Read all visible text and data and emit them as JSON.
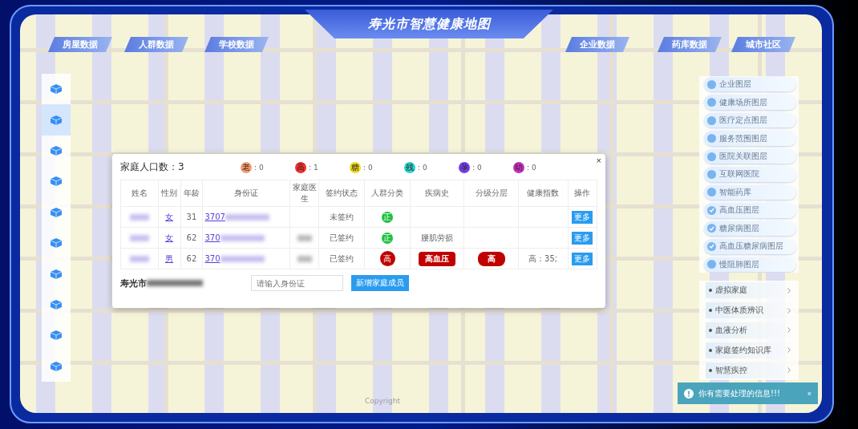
{
  "title": "寿光市智慧健康地图",
  "top_tabs": [
    {
      "label": "房屋数据"
    },
    {
      "label": "人群数据"
    },
    {
      "label": "学校数据"
    },
    {
      "label": "企业数据"
    },
    {
      "label": "药库数据"
    },
    {
      "label": "城市社区"
    }
  ],
  "sidebar": {
    "items": [
      {
        "selected": false
      },
      {
        "selected": true
      },
      {
        "selected": false
      },
      {
        "selected": false
      },
      {
        "selected": false
      },
      {
        "selected": false
      },
      {
        "selected": false
      },
      {
        "selected": false
      },
      {
        "selected": false
      },
      {
        "selected": false
      }
    ]
  },
  "layers": [
    {
      "label": "企业图层",
      "checked": false
    },
    {
      "label": "健康场所图层",
      "checked": false
    },
    {
      "label": "医疗定点图层",
      "checked": false
    },
    {
      "label": "服务范围图层",
      "checked": false
    },
    {
      "label": "医院关联图层",
      "checked": false
    },
    {
      "label": "互联网医院",
      "checked": false
    },
    {
      "label": "智能药库",
      "checked": false
    },
    {
      "label": "高血压图层",
      "checked": true
    },
    {
      "label": "糖尿病图层",
      "checked": true
    },
    {
      "label": "高血压糖尿病图层",
      "checked": true
    },
    {
      "label": "慢阻肺图层",
      "checked": false
    }
  ],
  "menu": [
    "虚拟家庭",
    "中医体质辨识",
    "血液分析",
    "家庭签约知识库",
    "智慧疾控"
  ],
  "dialog": {
    "title": "家庭人口数：3",
    "close": "×",
    "legend": [
      {
        "label": "老",
        "count": ": 0",
        "color": "#f0a070"
      },
      {
        "label": "高",
        "count": ": 1",
        "color": "#f03030"
      },
      {
        "label": "糖",
        "count": ": 0",
        "color": "#e8e020"
      },
      {
        "label": "残",
        "count": ": 0",
        "color": "#20d8d0"
      },
      {
        "label": "孕",
        "count": ": 0",
        "color": "#7040f0"
      },
      {
        "label": "幼",
        "count": ": 0",
        "color": "#c030c0"
      }
    ],
    "columns": [
      "姓名",
      "性别",
      "年龄",
      "身份证",
      "家庭医生",
      "签约状态",
      "人群分类",
      "疾病史",
      "分级分层",
      "健康指数",
      "操作"
    ],
    "rows": [
      {
        "gender": "女",
        "age": "31",
        "id": "3707",
        "doctor_redacted": false,
        "status": "未签约",
        "group": {
          "label": "正",
          "kind": "small",
          "color": "#20c040"
        },
        "action": "更多"
      },
      {
        "gender": "女",
        "age": "62",
        "id": "370",
        "doctor_redacted": true,
        "status": "已签约",
        "group": {
          "label": "正",
          "kind": "small",
          "color": "#20c040"
        },
        "disease": {
          "text": "腰肌劳损",
          "kind": "plain"
        },
        "action": "更多"
      },
      {
        "gender": "男",
        "age": "62",
        "id": "370",
        "doctor_redacted": true,
        "status": "已签约",
        "group": {
          "label": "高",
          "kind": "large",
          "color": "#c00000"
        },
        "disease": {
          "text": "高血压",
          "kind": "tag"
        },
        "grade": "高",
        "index": "高：35;",
        "action": "更多"
      }
    ],
    "address": "寿光市",
    "id_input": {
      "placeholder": "请输入身份证"
    },
    "add_button": "新增家庭成员"
  },
  "notification": {
    "text": "你有需要处理的信息!!!",
    "close": "×"
  },
  "footer": "Copyright"
}
